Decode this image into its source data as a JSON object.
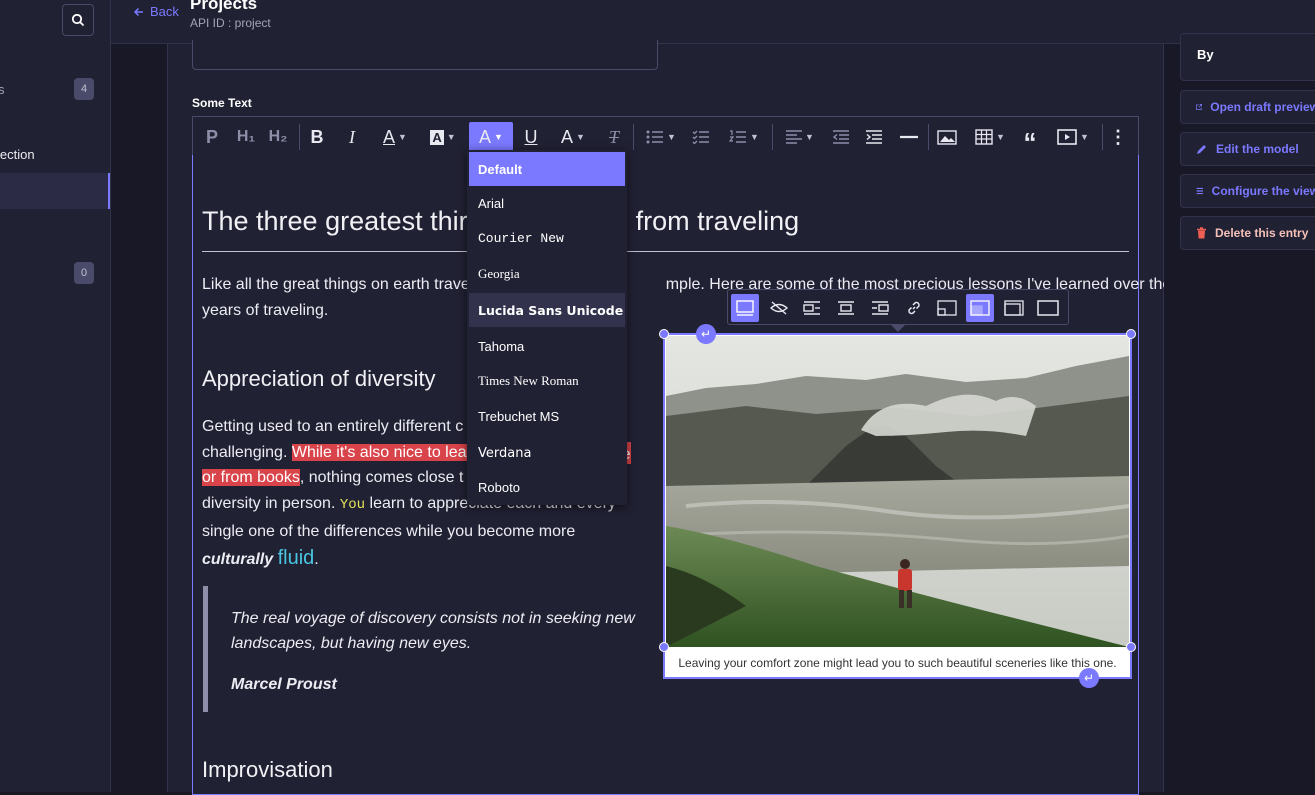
{
  "sidebar": {
    "partial_item_1": "s",
    "badge_1": "4",
    "partial_item_2": "lection",
    "badge_2": "0"
  },
  "header": {
    "back_label": "Back",
    "title": "Projects",
    "api_id": "API ID : project"
  },
  "field": {
    "label": "Some Text"
  },
  "toolbar": {
    "icons": [
      "paragraph-icon",
      "heading1-icon",
      "heading2-icon",
      "bold-icon",
      "italic-icon",
      "font-color-icon",
      "font-background-icon",
      "font-family-icon",
      "underline-icon",
      "font-size-icon",
      "remove-format-icon",
      "bulleted-list-icon",
      "todo-list-icon",
      "numbered-list-icon",
      "align-icon",
      "outdent-icon",
      "indent-icon",
      "horizontal-line-icon",
      "insert-image-icon",
      "table-icon",
      "blockquote-icon",
      "media-embed-icon",
      "more-icon"
    ],
    "paragraph": "P",
    "h1": "H₁",
    "h2": "H₂",
    "bold": "B",
    "italic": "I",
    "font_color": "A",
    "font_bg": "A",
    "font_family": "A",
    "underline": "U",
    "font_size": "A",
    "remove_format": "T",
    "more": "⋮"
  },
  "font_menu": {
    "options": [
      "Default",
      "Arial",
      "Courier New",
      "Georgia",
      "Lucida Sans Unicode",
      "Tahoma",
      "Times New Roman",
      "Trebuchet MS",
      "Verdana",
      "Roboto"
    ],
    "selected": "Default",
    "hovered": "Lucida Sans Unicode"
  },
  "document": {
    "h1_left": "The three greatest thir",
    "h1_right": "from traveling",
    "intro_line1_left": "Like all the great things on earth trave",
    "intro_line1_right": "mple. Here are some of the most precious lessons I've learned over the",
    "intro_line2": "years of traveling.",
    "h2_diversity": "Appreciation of diversity",
    "p_a": "Getting used to an entirely different c",
    "p_b_plain": "challenging. ",
    "p_b_hl": "While it's also nice to lea",
    "p_b_hl_right": "e",
    "p_c_hl": "or from books",
    "p_c_plain": ", nothing comes close t",
    "p_d_plain": "diversity in person. ",
    "p_d_code": "You",
    "p_d_rest": " learn to appre",
    "p_d_tail": "ciate each and every",
    "p_e": "single one of the differences while you become more",
    "p_f_bold": "culturally",
    "p_f_fluid": "fluid",
    "p_f_dot": ".",
    "quote_line1": "The real voyage of discovery consists not in seeking new",
    "quote_line2": "landscapes, but having new eyes.",
    "quote_author": "Marcel Proust",
    "h2_improvisation": "Improvisation",
    "image_caption": "Leaving your comfort zone might lead you to such beautiful sceneries like this one."
  },
  "image_toolbar": {
    "icons": [
      "inline-image-icon",
      "toggle-caption-icon",
      "wrap-left-icon",
      "block-center-icon",
      "wrap-right-icon",
      "link-icon",
      "resize-small-icon",
      "resize-medium-icon",
      "resize-large-icon",
      "resize-original-icon"
    ]
  },
  "right_panel": {
    "by_label": "By",
    "actions": {
      "open_draft_preview": "Open draft preview",
      "edit_model": "Edit the model",
      "configure_view": "Configure the view",
      "delete_entry": "Delete this entry"
    }
  },
  "colors": {
    "accent": "#7b79ff",
    "highlight_red": "#d9434a",
    "danger": "#ee5e52",
    "fluid_cyan": "#49c5e0",
    "code_yellow": "#e7e35a"
  }
}
